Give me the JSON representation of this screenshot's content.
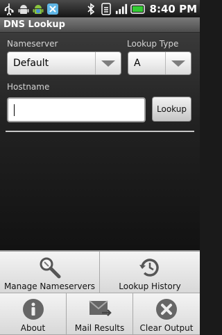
{
  "status_bar": {
    "time": "8:40",
    "ampm": "PM",
    "icons": [
      "usb-icon",
      "android-icon",
      "android-market-icon",
      "app-icon",
      "bluetooth-icon",
      "wifi-icon",
      "signal-icon",
      "battery-icon"
    ]
  },
  "app": {
    "title": "DNS Lookup"
  },
  "form": {
    "nameserver_label": "Nameserver",
    "nameserver_value": "Default",
    "lookup_type_label": "Lookup Type",
    "lookup_type_value": "A",
    "hostname_label": "Hostname",
    "hostname_value": "",
    "lookup_button": "Lookup"
  },
  "menu": {
    "items": [
      {
        "label": "Manage Nameservers",
        "icon": "magnifier-wrench-icon"
      },
      {
        "label": "Lookup History",
        "icon": "history-icon"
      },
      {
        "label": "About",
        "icon": "info-icon"
      },
      {
        "label": "Mail Results",
        "icon": "mail-icon"
      },
      {
        "label": "Clear Output",
        "icon": "close-circle-icon"
      }
    ]
  },
  "colors": {
    "battery": "#33cc33",
    "menu_bg": "#e8e8e8"
  }
}
